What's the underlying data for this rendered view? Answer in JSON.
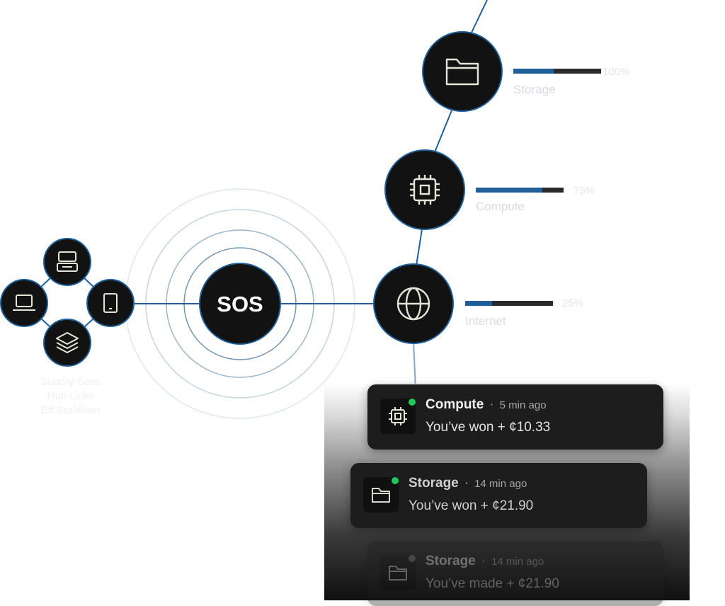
{
  "center": {
    "label": "SOS"
  },
  "devices": {
    "icons": [
      "server-icon",
      "laptop-icon",
      "tablet-icon",
      "layers-icon"
    ],
    "caption": [
      "Sundry Sees",
      "Hub Links",
      "Eff Stabiliser"
    ]
  },
  "resources": [
    {
      "id": "storage",
      "label": "Storage",
      "percent_text": "100%",
      "fill": 0.46,
      "icon": "folder-icon"
    },
    {
      "id": "compute",
      "label": "Compute",
      "percent_text": "75%",
      "fill": 0.76,
      "icon": "cpu-icon"
    },
    {
      "id": "internet",
      "label": "Internet",
      "percent_text": "25%",
      "fill": 0.31,
      "icon": "globe-icon"
    }
  ],
  "feed": [
    {
      "title": "Compute",
      "time": "5 min ago",
      "message": "You’ve won + ¢10.33",
      "icon": "cpu-icon",
      "status": "online"
    },
    {
      "title": "Storage",
      "time": "14 min ago",
      "message": "You’ve won + ¢21.90",
      "icon": "folder-icon",
      "status": "online"
    },
    {
      "title": "Storage",
      "time": "14 min ago",
      "message": "You’ve made + ¢21.90",
      "icon": "folder-icon",
      "status": "idle"
    }
  ],
  "colors": {
    "line": "#1f5f99",
    "node": "#121212",
    "ring": "#5a7fa3",
    "bar_track": "#2b2b2b",
    "status_online": "#22c55e"
  }
}
